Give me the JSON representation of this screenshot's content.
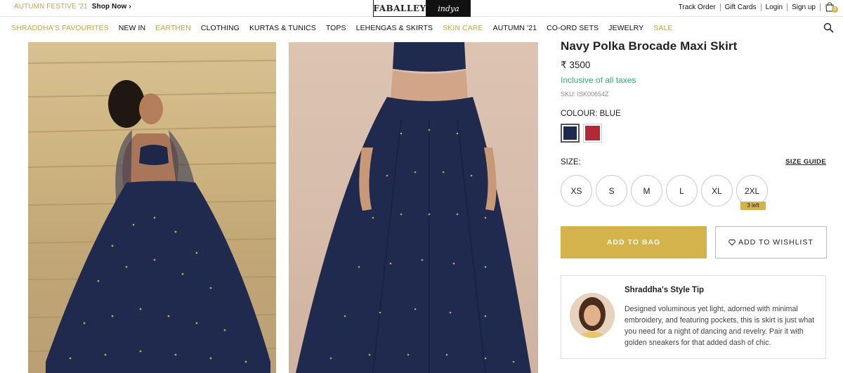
{
  "topbar": {
    "promo_label": "AUTUMN FESTIVE '21",
    "promo_link": "Shop Now",
    "brand_primary": "FABALLEY",
    "brand_secondary": "indya",
    "links": [
      "Track Order",
      "Gift Cards",
      "Login",
      "Sign up"
    ],
    "bag_count": "0"
  },
  "nav": {
    "items": [
      {
        "label": "SHRADDHA'S FAVOURITES",
        "accent": true
      },
      {
        "label": "NEW IN",
        "accent": false
      },
      {
        "label": "EARTHEN",
        "accent": true
      },
      {
        "label": "CLOTHING",
        "accent": false
      },
      {
        "label": "KURTAS & TUNICS",
        "accent": false
      },
      {
        "label": "TOPS",
        "accent": false
      },
      {
        "label": "LEHENGAS & SKIRTS",
        "accent": false
      },
      {
        "label": "SKIN CARE",
        "accent": true
      },
      {
        "label": "AUTUMN '21",
        "accent": false
      },
      {
        "label": "CO-ORD SETS",
        "accent": false
      },
      {
        "label": "JEWELRY",
        "accent": false
      },
      {
        "label": "SALE",
        "accent": true
      }
    ]
  },
  "product": {
    "title": "Navy Polka Brocade Maxi Skirt",
    "price": "₹ 3500",
    "tax_note": "Inclusive of all taxes",
    "sku": "SKU: ISK00654Z",
    "colour_label": "COLOUR:",
    "colour_value": "BLUE",
    "swatches": [
      {
        "name": "navy",
        "color": "#1d2a4e",
        "selected": true
      },
      {
        "name": "maroon",
        "color": "#b22a38",
        "selected": false
      }
    ],
    "size_label": "SIZE:",
    "size_guide": "SIZE GUIDE",
    "sizes": [
      "XS",
      "S",
      "M",
      "L",
      "XL",
      "2XL"
    ],
    "size_badge": "3 left",
    "add_to_bag": "ADD TO BAG",
    "add_to_wishlist": "ADD TO WISHLIST"
  },
  "style_tip": {
    "title": "Shraddha's Style Tip",
    "text": "Designed voluminous yet light, adorned with minimal embroidery, and featuring pockets, this is skirt is just what you need for a night of dancing and revelry. Pair it with golden sneakers for that added dash of chic."
  },
  "colors": {
    "accent_gold": "#d4b24c",
    "nav_gold": "#c7a54c",
    "success_green": "#2fb36b",
    "navy": "#1d2a4e"
  }
}
